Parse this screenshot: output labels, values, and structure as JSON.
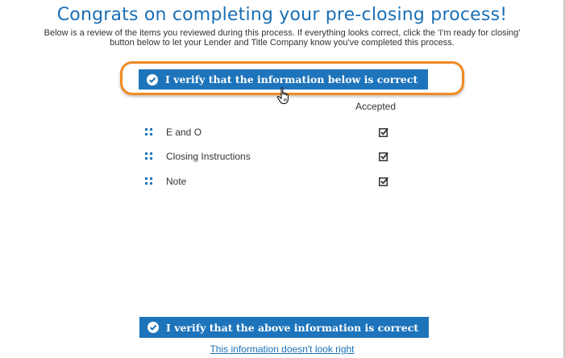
{
  "header": {
    "title": "Congrats on completing your pre-closing process!",
    "intro_line1": "Below is a review of the items you reviewed during this process. If everything looks correct, click the 'I'm ready for closing'",
    "intro_line2": "button below to let your Lender and Title Company know you've completed this process."
  },
  "top_button": {
    "label": "I verify that the information below is correct",
    "icon": "check-circle-icon"
  },
  "table": {
    "column_header": "Accepted",
    "items": [
      {
        "label": "E and O",
        "accepted": true
      },
      {
        "label": "Closing Instructions",
        "accepted": true
      },
      {
        "label": "Note",
        "accepted": true
      }
    ]
  },
  "bottom_button": {
    "label": "I verify that the above information is correct",
    "icon": "check-circle-icon"
  },
  "link": {
    "label": "This information doesn't look right"
  },
  "colors": {
    "title": "#1a6fb5",
    "button": "#1d74bb",
    "highlight": "#f08a22",
    "grip": "#1d74bb"
  }
}
